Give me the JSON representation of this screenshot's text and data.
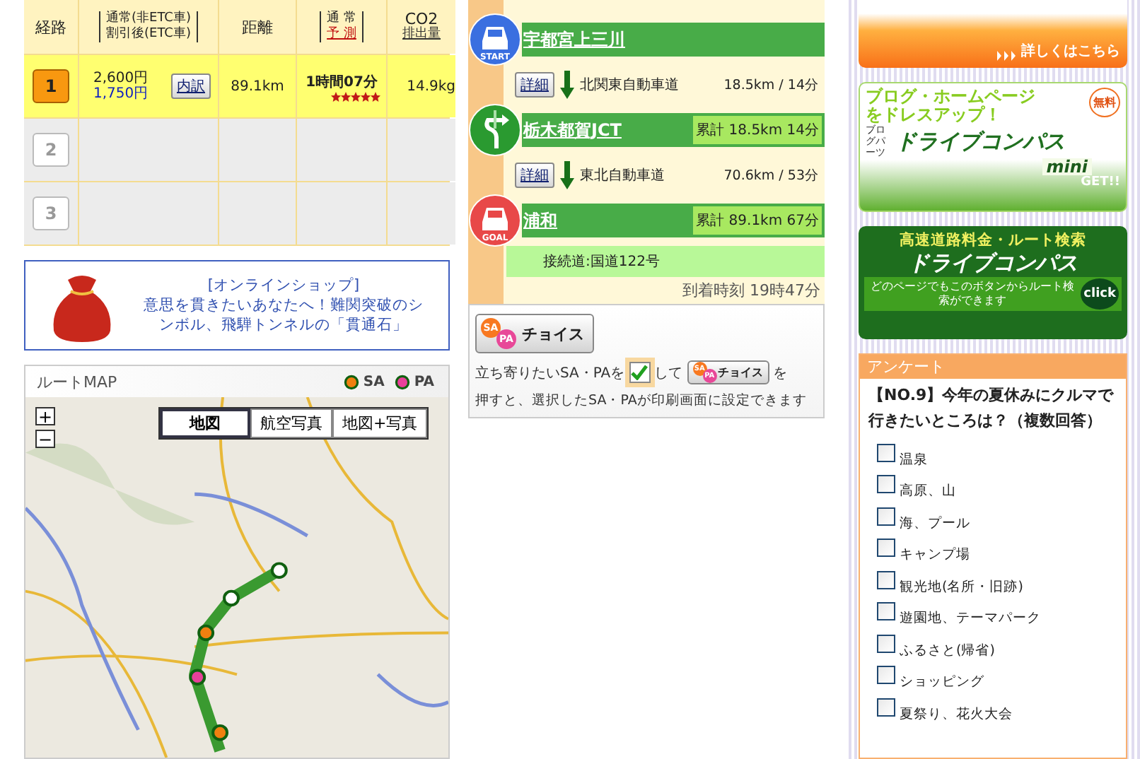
{
  "route_table": {
    "columns": [
      {
        "kind": "plain",
        "lines": [
          {
            "text": "経路",
            "link": false
          }
        ]
      },
      {
        "kind": "bracket",
        "lines": [
          {
            "text": "通常(非ETC車)",
            "link": false
          },
          {
            "text": "割引後(ETC車)",
            "link": false
          }
        ]
      },
      {
        "kind": "plain",
        "lines": [
          {
            "text": "距離",
            "link": false
          }
        ]
      },
      {
        "kind": "bracket",
        "lines": [
          {
            "text": "通 常",
            "link": false
          },
          {
            "text": "予 測",
            "link": true
          }
        ]
      },
      {
        "kind": "plain",
        "lines": [
          {
            "text": "CO2",
            "link": false
          },
          {
            "text": "排出量",
            "link": true
          }
        ]
      }
    ],
    "rows": [
      {
        "number": "1",
        "selected": true,
        "toll_normal": "2,600円",
        "toll_discount": "1,750円",
        "breakdown": "内訳",
        "distance": "89.1km",
        "time": "1時間07分",
        "stars": 5,
        "co2": "14.9kg"
      },
      {
        "number": "2",
        "selected": false
      },
      {
        "number": "3",
        "selected": false
      }
    ]
  },
  "shop_banner": {
    "title": "[オンラインショップ]",
    "text": "意思を貫きたいあなたへ！難関突破のシンボル、飛騨トンネルの「貫通石」"
  },
  "route_map": {
    "title": "ルートMAP",
    "legend": [
      {
        "label": "SA",
        "color": "#f08010"
      },
      {
        "label": "PA",
        "color": "#e8409a"
      }
    ],
    "zoom_in": "+",
    "zoom_out": "−",
    "view_tabs": [
      {
        "label": "地図",
        "selected": true
      },
      {
        "label": "航空写真",
        "selected": false
      },
      {
        "label": "地図+写真",
        "selected": false
      }
    ]
  },
  "route_steps": [
    {
      "kind": "start",
      "badge": "START",
      "name": "宇都宮上三川"
    },
    {
      "kind": "segment",
      "button": "詳細",
      "road": "北関東自動車道",
      "distance": "18.5km / 14分"
    },
    {
      "kind": "junction",
      "name": "栃木都賀JCT",
      "cumulative": "累計 18.5km 14分"
    },
    {
      "kind": "segment",
      "button": "詳細",
      "road": "東北自動車道",
      "distance": "70.6km / 53分"
    },
    {
      "kind": "goal",
      "badge": "GOAL",
      "name": "浦和",
      "cumulative": "累計 89.1km 67分"
    }
  ],
  "connection": "接続道:国道122号",
  "arrival": "到着時刻 19時47分",
  "sapa": {
    "sa": "SA",
    "pa": "PA",
    "label": "チョイス",
    "text_before": "立ち寄りたいSA・PAを",
    "checked": true,
    "text_mid": "して",
    "sample_sa": "SA",
    "sample_pa": "PA",
    "sample_label": "チョイス",
    "text_after": "を",
    "line2": "押すと、選択したSA・PAが印刷画面に設定できます"
  },
  "banners": {
    "mobile_link": "詳しくはこちら",
    "mini": {
      "headline": "ブログ・ホームページをドレスアップ！",
      "free": "無料",
      "parts": "ブログパーツ",
      "title": "ドライブコンパス",
      "sub": "mini",
      "get": "GET!!"
    },
    "search": {
      "headline": "高速道路料金・ルート検索",
      "title": "ドライブコンパス",
      "text": "どのページでもこのボタンからルート検索ができます",
      "click": "click"
    }
  },
  "survey": {
    "header": "アンケート",
    "question": "【NO.9】今年の夏休みにクルマで行きたいところは？（複数回答）",
    "options": [
      {
        "label": "温泉",
        "checked": false
      },
      {
        "label": "高原、山",
        "checked": false
      },
      {
        "label": "海、プール",
        "checked": false
      },
      {
        "label": "キャンプ場",
        "checked": false
      },
      {
        "label": "観光地(名所・旧跡)",
        "checked": false
      },
      {
        "label": "遊園地、テーマパーク",
        "checked": false
      },
      {
        "label": "ふるさと(帰省)",
        "checked": false
      },
      {
        "label": "ショッピング",
        "checked": false
      },
      {
        "label": "夏祭り、花火大会",
        "checked": false
      }
    ]
  }
}
